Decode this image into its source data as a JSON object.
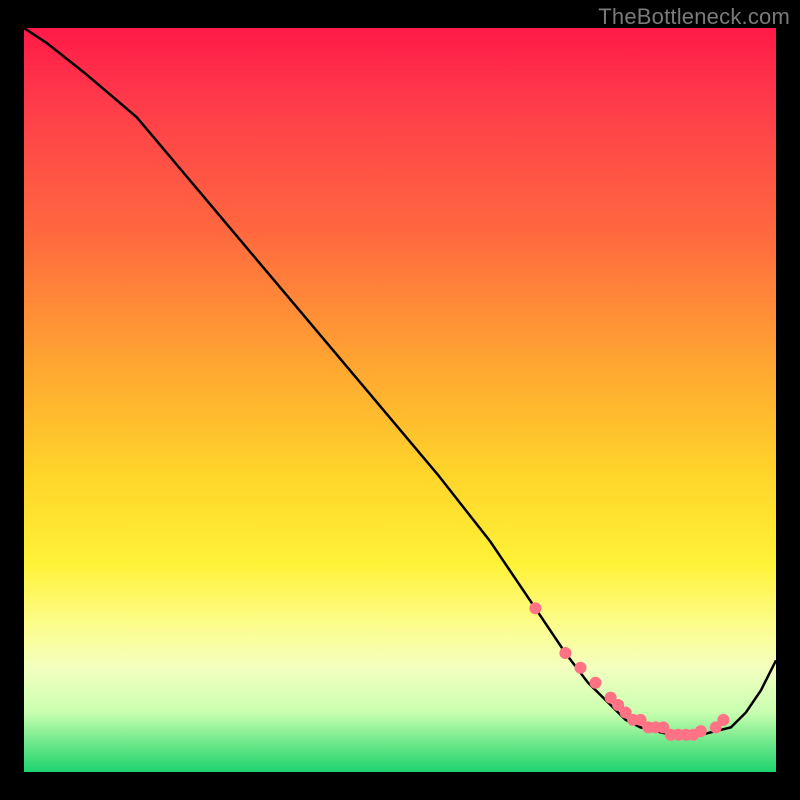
{
  "watermark": "TheBottleneck.com",
  "chart_data": {
    "type": "line",
    "title": "",
    "xlabel": "",
    "ylabel": "",
    "xlim": [
      0,
      100
    ],
    "ylim": [
      0,
      100
    ],
    "series": [
      {
        "name": "curve",
        "x": [
          0,
          3,
          8,
          15,
          25,
          35,
          45,
          55,
          62,
          68,
          72,
          75,
          78,
          80,
          82,
          84,
          86,
          88,
          90,
          92,
          94,
          96,
          98,
          100
        ],
        "y": [
          100,
          98,
          94,
          88,
          76,
          64,
          52,
          40,
          31,
          22,
          16,
          12,
          9,
          7,
          6,
          5.5,
          5,
          5,
          5,
          5.5,
          6,
          8,
          11,
          15
        ]
      }
    ],
    "markers": {
      "name": "highlight-dots",
      "x": [
        68,
        72,
        74,
        76,
        78,
        79,
        80,
        81,
        82,
        83,
        84,
        85,
        86,
        87,
        88,
        89,
        90,
        92,
        93
      ],
      "y": [
        22,
        16,
        14,
        12,
        10,
        9,
        8,
        7,
        7,
        6,
        6,
        6,
        5,
        5,
        5,
        5,
        5.5,
        6,
        7
      ],
      "r": 6
    },
    "gradient_stops": [
      {
        "pos": 0,
        "color": "#ff1a48"
      },
      {
        "pos": 10,
        "color": "#ff3b4a"
      },
      {
        "pos": 28,
        "color": "#ff6a3f"
      },
      {
        "pos": 45,
        "color": "#ffa531"
      },
      {
        "pos": 60,
        "color": "#ffd52a"
      },
      {
        "pos": 72,
        "color": "#fff237"
      },
      {
        "pos": 80,
        "color": "#fdfd8a"
      },
      {
        "pos": 86,
        "color": "#f3ffbf"
      },
      {
        "pos": 92,
        "color": "#c9ffb0"
      },
      {
        "pos": 96,
        "color": "#6fe88a"
      },
      {
        "pos": 100,
        "color": "#1ed36f"
      }
    ]
  }
}
